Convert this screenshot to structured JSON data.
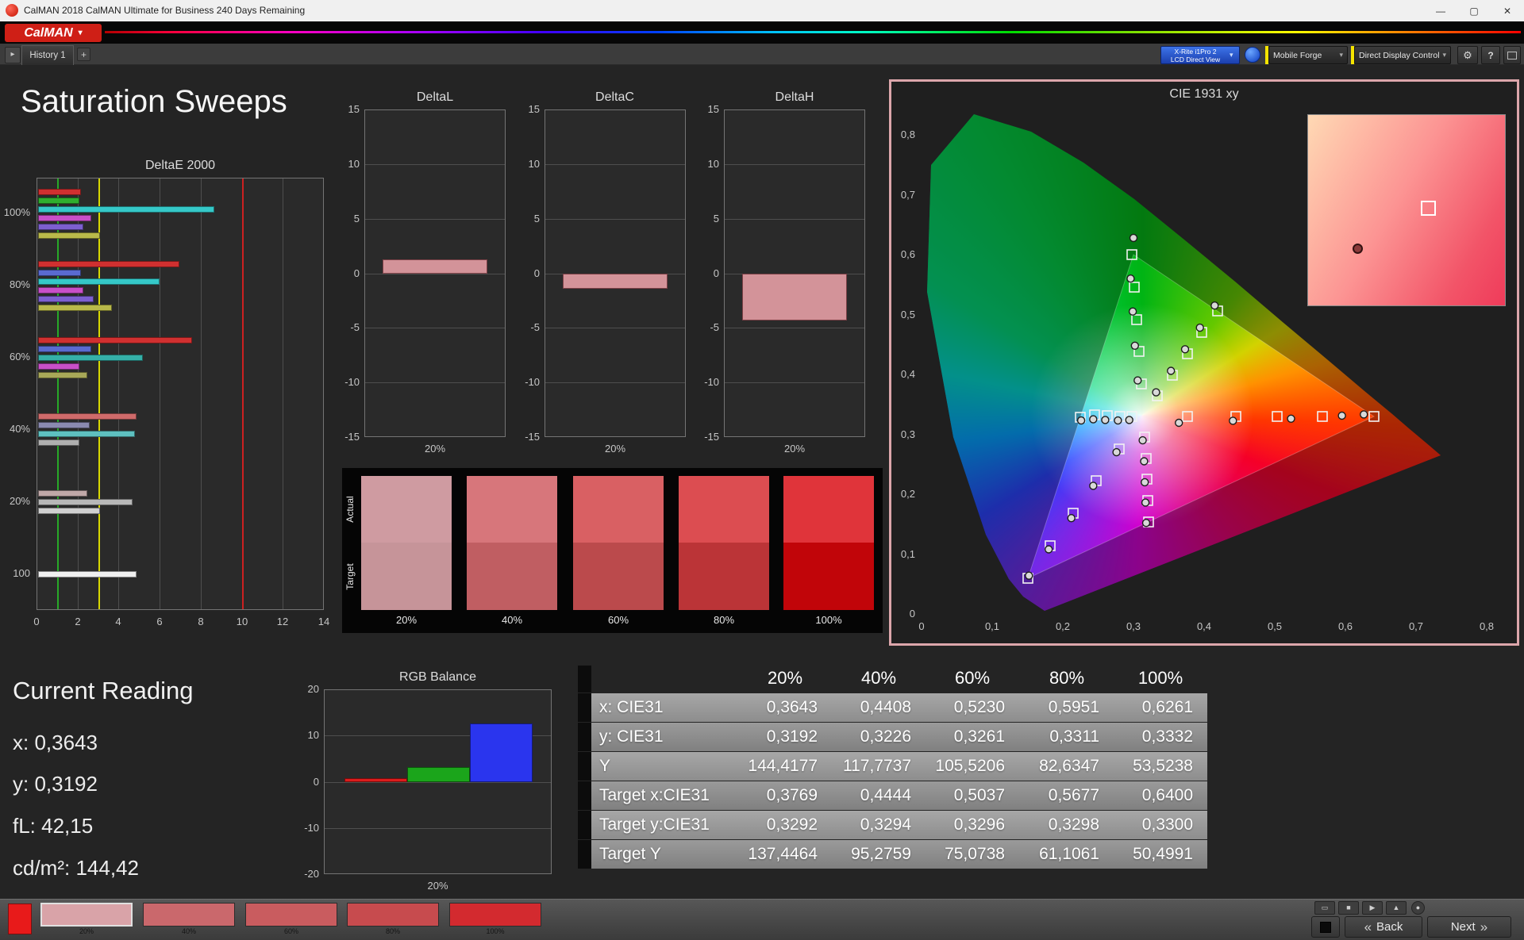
{
  "window": {
    "title": "CalMAN 2018 CalMAN Ultimate for Business 240 Days Remaining"
  },
  "logo": {
    "text": "CalMAN"
  },
  "icons": {
    "minimize": "—",
    "maximize": "▢",
    "close": "✕",
    "dropdown": "▾",
    "tab_nav": "▸",
    "add_tab": "+",
    "gear": "⚙",
    "help": "?",
    "back_chevrons": "«",
    "next_chevrons": "»",
    "display": "▭",
    "stop": "■",
    "play": "▶",
    "eject": "▲",
    "record": "●"
  },
  "toolbar": {
    "history_tab": "History 1",
    "meter": {
      "line1": "X-Rite i1Pro 2",
      "line2": "LCD Direct View"
    },
    "source": "Mobile Forge",
    "display_control": "Direct Display Control"
  },
  "page": {
    "title": "Saturation Sweeps"
  },
  "current_reading": {
    "title": "Current Reading",
    "lines": [
      "x: 0,3643",
      "y: 0,3192",
      "fL: 42,15",
      "cd/m²: 144,42"
    ]
  },
  "saturation_swatches": {
    "row_labels": [
      "Actual",
      "Target"
    ],
    "columns": [
      {
        "label": "20%",
        "actual": "#cf9ba1",
        "target": "#c69499"
      },
      {
        "label": "40%",
        "actual": "#d7767b",
        "target": "#c05e62"
      },
      {
        "label": "60%",
        "actual": "#d96063",
        "target": "#bb4a4c"
      },
      {
        "label": "80%",
        "actual": "#dc4d51",
        "target": "#bb3437"
      },
      {
        "label": "100%",
        "actual": "#e0343a",
        "target": "#c10509"
      }
    ]
  },
  "table": {
    "columns": [
      "20%",
      "40%",
      "60%",
      "80%",
      "100%"
    ],
    "rows": [
      {
        "label": "x: CIE31",
        "values": [
          "0,3643",
          "0,4408",
          "0,5230",
          "0,5951",
          "0,6261"
        ]
      },
      {
        "label": "y: CIE31",
        "values": [
          "0,3192",
          "0,3226",
          "0,3261",
          "0,3311",
          "0,3332"
        ]
      },
      {
        "label": "Y",
        "values": [
          "144,4177",
          "117,7737",
          "105,5206",
          "82,6347",
          "53,5238"
        ]
      },
      {
        "label": "Target x:CIE31",
        "values": [
          "0,3769",
          "0,4444",
          "0,5037",
          "0,5677",
          "0,6400"
        ]
      },
      {
        "label": "Target y:CIE31",
        "values": [
          "0,3292",
          "0,3294",
          "0,3296",
          "0,3298",
          "0,3300"
        ]
      },
      {
        "label": "Target Y",
        "values": [
          "137,4464",
          "95,2759",
          "75,0738",
          "61,1061",
          "50,4991"
        ]
      }
    ]
  },
  "bottom_bar": {
    "current_patch_color": "#e81a1a",
    "swatches": [
      {
        "label": "20%",
        "color": "#d9a3a8",
        "selected": true
      },
      {
        "label": "40%",
        "color": "#ca686c",
        "selected": false
      },
      {
        "label": "60%",
        "color": "#c95c5f",
        "selected": false
      },
      {
        "label": "80%",
        "color": "#c74b4e",
        "selected": false
      },
      {
        "label": "100%",
        "color": "#d32a2f",
        "selected": false
      }
    ],
    "back_label": "Back",
    "next_label": "Next"
  },
  "chart_data": [
    {
      "id": "deltae2000",
      "type": "bar",
      "orientation": "horizontal",
      "title": "DeltaE 2000",
      "xlim": [
        0,
        14
      ],
      "xticks": [
        0,
        2,
        4,
        6,
        8,
        10,
        12,
        14
      ],
      "reference_lines": [
        {
          "x": 1,
          "color": "#28a828"
        },
        {
          "x": 3,
          "color": "#d8d800"
        },
        {
          "x": 10,
          "color": "#cc2020"
        }
      ],
      "groups": [
        {
          "label": "100%",
          "bars": [
            {
              "color": "#d03030",
              "value": 2.1
            },
            {
              "color": "#2fae2f",
              "value": 2.0
            },
            {
              "color": "#35c8c8",
              "value": 8.6
            },
            {
              "color": "#c84fc8",
              "value": 2.6
            },
            {
              "color": "#7d5fd0",
              "value": 2.2
            },
            {
              "color": "#b9b94a",
              "value": 3.0
            }
          ]
        },
        {
          "label": "80%",
          "bars": [
            {
              "color": "#d03030",
              "value": 6.9
            },
            {
              "color": "#5a6ad0",
              "value": 2.1
            },
            {
              "color": "#35c8c8",
              "value": 5.9
            },
            {
              "color": "#c84fc8",
              "value": 2.2
            },
            {
              "color": "#7d5fd0",
              "value": 2.7
            },
            {
              "color": "#b9b94a",
              "value": 3.6
            }
          ]
        },
        {
          "label": "60%",
          "bars": [
            {
              "color": "#d03030",
              "value": 7.5
            },
            {
              "color": "#5a6ad0",
              "value": 2.6
            },
            {
              "color": "#35b0a8",
              "value": 5.1
            },
            {
              "color": "#c84fc8",
              "value": 2.0
            },
            {
              "color": "#a8a858",
              "value": 2.4
            }
          ]
        },
        {
          "label": "40%",
          "bars": [
            {
              "color": "#cf6a6a",
              "value": 4.8
            },
            {
              "color": "#8a8ab0",
              "value": 2.5
            },
            {
              "color": "#5ec0c0",
              "value": 4.7
            },
            {
              "color": "#b0b0b0",
              "value": 2.0
            }
          ]
        },
        {
          "label": "20%",
          "bars": [
            {
              "color": "#c0a8a8",
              "value": 2.4
            },
            {
              "color": "#b8b8b8",
              "value": 4.6
            },
            {
              "color": "#d0d0d0",
              "value": 3.0
            }
          ]
        },
        {
          "label": "100",
          "bars": [
            {
              "color": "#f0f0f0",
              "value": 4.8
            }
          ]
        }
      ]
    },
    {
      "id": "deltaL",
      "type": "bar",
      "title": "DeltaL",
      "ylim": [
        -15,
        15
      ],
      "yticks": [
        15,
        10,
        5,
        0,
        -5,
        -10,
        -15
      ],
      "xlabel": "20%",
      "value": 1.3,
      "bar_color": "#d39399"
    },
    {
      "id": "deltaC",
      "type": "bar",
      "title": "DeltaC",
      "ylim": [
        -15,
        15
      ],
      "yticks": [
        15,
        10,
        5,
        0,
        -5,
        -10,
        -15
      ],
      "xlabel": "20%",
      "value": -1.4,
      "bar_color": "#d39399"
    },
    {
      "id": "deltaH",
      "type": "bar",
      "title": "DeltaH",
      "ylim": [
        -15,
        15
      ],
      "yticks": [
        15,
        10,
        5,
        0,
        -5,
        -10,
        -15
      ],
      "xlabel": "20%",
      "value": -4.3,
      "bar_color": "#d39399"
    },
    {
      "id": "cie1931",
      "type": "scatter",
      "title": "CIE 1931 xy",
      "xlim": [
        0,
        0.8
      ],
      "ylim": [
        0,
        0.8
      ],
      "xticks": [
        "0",
        "0,1",
        "0,2",
        "0,3",
        "0,4",
        "0,5",
        "0,6",
        "0,7",
        "0,8"
      ],
      "yticks": [
        "0",
        "0,1",
        "0,2",
        "0,3",
        "0,4",
        "0,5",
        "0,6",
        "0,7",
        "0,8"
      ],
      "gamut_triangle": [
        [
          0.64,
          0.33
        ],
        [
          0.3,
          0.6
        ],
        [
          0.15,
          0.06
        ]
      ],
      "target_points": [
        [
          0.3769,
          0.3292
        ],
        [
          0.4444,
          0.3294
        ],
        [
          0.5037,
          0.3296
        ],
        [
          0.5677,
          0.3298
        ],
        [
          0.64,
          0.33
        ],
        [
          0.311,
          0.384
        ],
        [
          0.3075,
          0.438
        ],
        [
          0.3043,
          0.492
        ],
        [
          0.301,
          0.546
        ],
        [
          0.298,
          0.6
        ],
        [
          0.28,
          0.276
        ],
        [
          0.247,
          0.222
        ],
        [
          0.215,
          0.168
        ],
        [
          0.182,
          0.114
        ],
        [
          0.15,
          0.06
        ],
        [
          0.298,
          0.3295
        ],
        [
          0.281,
          0.33
        ],
        [
          0.263,
          0.331
        ],
        [
          0.245,
          0.332
        ],
        [
          0.225,
          0.329
        ],
        [
          0.316,
          0.295
        ],
        [
          0.318,
          0.26
        ],
        [
          0.3195,
          0.225
        ],
        [
          0.3205,
          0.19
        ],
        [
          0.321,
          0.154
        ],
        [
          0.334,
          0.364
        ],
        [
          0.355,
          0.399
        ],
        [
          0.376,
          0.434
        ],
        [
          0.397,
          0.47
        ],
        [
          0.4193,
          0.5053
        ]
      ],
      "measured_points": [
        [
          0.3643,
          0.3192
        ],
        [
          0.4408,
          0.3226
        ],
        [
          0.523,
          0.3261
        ],
        [
          0.5951,
          0.3311
        ],
        [
          0.6261,
          0.3332
        ],
        [
          0.306,
          0.39
        ],
        [
          0.302,
          0.448
        ],
        [
          0.299,
          0.505
        ],
        [
          0.296,
          0.56
        ],
        [
          0.3,
          0.628
        ],
        [
          0.276,
          0.27
        ],
        [
          0.243,
          0.214
        ],
        [
          0.212,
          0.16
        ],
        [
          0.18,
          0.108
        ],
        [
          0.152,
          0.064
        ],
        [
          0.294,
          0.324
        ],
        [
          0.278,
          0.323
        ],
        [
          0.26,
          0.324
        ],
        [
          0.243,
          0.325
        ],
        [
          0.226,
          0.323
        ],
        [
          0.313,
          0.29
        ],
        [
          0.315,
          0.255
        ],
        [
          0.316,
          0.22
        ],
        [
          0.317,
          0.186
        ],
        [
          0.318,
          0.152
        ],
        [
          0.332,
          0.37
        ],
        [
          0.353,
          0.406
        ],
        [
          0.373,
          0.442
        ],
        [
          0.394,
          0.478
        ],
        [
          0.415,
          0.515
        ]
      ]
    },
    {
      "id": "rgb_balance",
      "type": "bar",
      "title": "RGB Balance",
      "ylim": [
        -20,
        20
      ],
      "yticks": [
        20,
        10,
        0,
        -10,
        -20
      ],
      "xlabel": "20%",
      "series": [
        {
          "name": "Red",
          "value": 0.8,
          "color": "#dd1c1c"
        },
        {
          "name": "Green",
          "value": 3.2,
          "color": "#1ba51b"
        },
        {
          "name": "Blue",
          "value": 12.7,
          "color": "#2a35ee"
        }
      ]
    }
  ]
}
